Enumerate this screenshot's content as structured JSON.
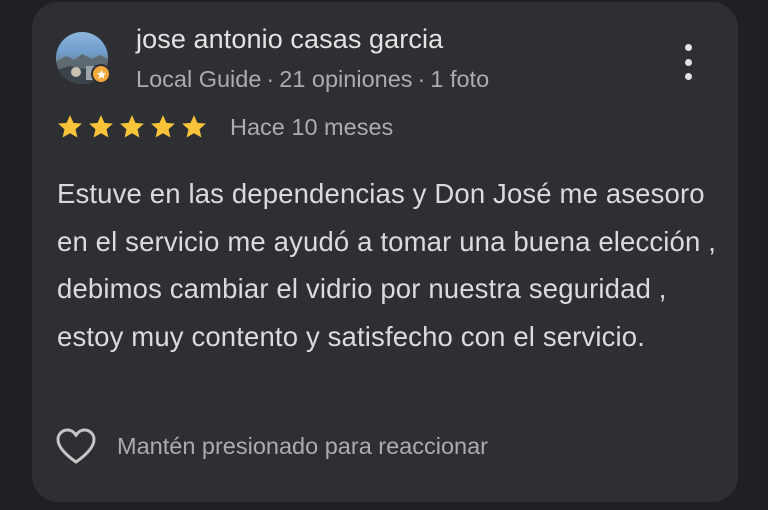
{
  "review": {
    "reviewer": {
      "name": "jose antonio casas garcia",
      "badge": "Local Guide",
      "reviews_count": "21 opiniones",
      "photos_count": "1 foto",
      "separator": "·",
      "badge_icon": "star-badge-icon",
      "badge_color": "#f0a93a"
    },
    "rating": 5,
    "rating_max": 5,
    "star_color": "#f9c33a",
    "time_ago": "Hace 10 meses",
    "text": "Estuve en las dependencias y Don José me asesoro en el servicio me ayudó a tomar una buena elección , debimos cambiar el vidrio por nuestra seguridad , estoy muy contento y satisfecho con el servicio.",
    "more_icon": "more-vert-icon",
    "reaction": {
      "icon": "heart-outline-icon",
      "label": "Mantén presionado para reaccionar"
    }
  },
  "colors": {
    "background": "#1f2024",
    "card": "#2d2f33",
    "primary_text": "#e3e3e3",
    "secondary_text": "#a9acb0"
  }
}
